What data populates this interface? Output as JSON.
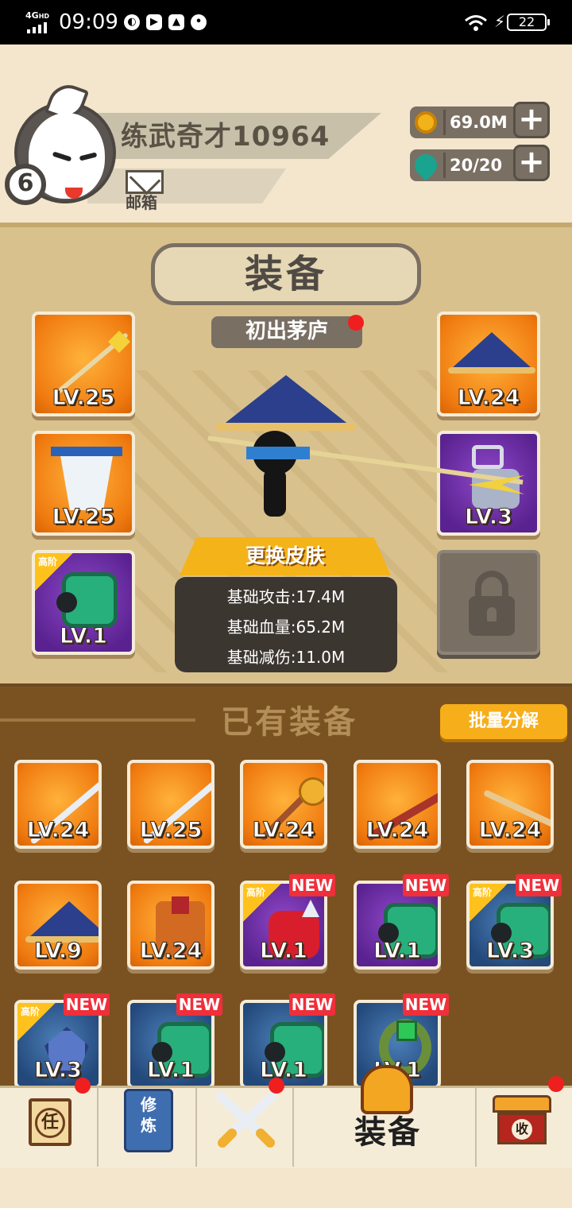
{
  "status_bar": {
    "network": "4G",
    "network_sup": "HD",
    "time": "09:09",
    "battery": "22"
  },
  "player": {
    "name": "练武奇才10964",
    "level": "6",
    "mail_label": "邮箱"
  },
  "resources": {
    "coins": "69.0M",
    "gems": "20/20",
    "add_symbol": "+"
  },
  "equipment": {
    "title": "装备",
    "skin_name": "初出茅庐",
    "change_skin_label": "更换皮肤",
    "stats": [
      "基础攻击:17.4M",
      "基础血量:65.2M",
      "基础减伤:11.0M"
    ],
    "slots": [
      {
        "item": "spear",
        "level": "LV.25",
        "color": "orange"
      },
      {
        "item": "hat",
        "level": "LV.24",
        "color": "orange"
      },
      {
        "item": "robe",
        "level": "LV.25",
        "color": "orange"
      },
      {
        "item": "spiked-gauntlet",
        "level": "LV.3",
        "color": "purple"
      },
      {
        "item": "bracer",
        "level": "LV.1",
        "color": "purple",
        "tier": "高阶"
      },
      {
        "item": "lock",
        "level": "",
        "color": "locked"
      }
    ]
  },
  "inventory": {
    "title": "已有装备",
    "batch_button": "批量分解",
    "items": [
      {
        "item": "sword",
        "level": "LV.24",
        "color": "orange"
      },
      {
        "item": "sword",
        "level": "LV.25",
        "color": "orange"
      },
      {
        "item": "mace",
        "level": "LV.24",
        "color": "orange"
      },
      {
        "item": "staff",
        "level": "LV.24",
        "color": "orange"
      },
      {
        "item": "spear",
        "level": "LV.24",
        "color": "orange"
      },
      {
        "item": "hat",
        "level": "LV.9",
        "color": "orange"
      },
      {
        "item": "armor",
        "level": "LV.24",
        "color": "orange"
      },
      {
        "item": "red-gauntlet",
        "level": "LV.1",
        "color": "purple",
        "tier": "高阶",
        "new": "NEW"
      },
      {
        "item": "bracer",
        "level": "LV.1",
        "color": "purple",
        "new": "NEW"
      },
      {
        "item": "bracer",
        "level": "LV.3",
        "color": "blue",
        "tier": "高阶",
        "new": "NEW"
      },
      {
        "item": "amulet",
        "level": "LV.3",
        "color": "blue",
        "tier": "高阶",
        "new": "NEW"
      },
      {
        "item": "bracer",
        "level": "LV.1",
        "color": "blue",
        "new": "NEW"
      },
      {
        "item": "bracer",
        "level": "LV.1",
        "color": "blue",
        "new": "NEW"
      },
      {
        "item": "ring",
        "level": "LV.1",
        "color": "blue",
        "new": "NEW"
      }
    ]
  },
  "bottom_nav": {
    "task_glyph": "任",
    "cultivate_glyph_1": "修",
    "cultivate_glyph_2": "炼",
    "equip_label": "装备",
    "collect_glyph": "收"
  },
  "colors": {
    "orange_card": "#f07b10",
    "purple_card": "#5a2290",
    "blue_card": "#23487a",
    "new_tag": "#ef2f3a",
    "notification_dot": "#ef1f1f"
  }
}
